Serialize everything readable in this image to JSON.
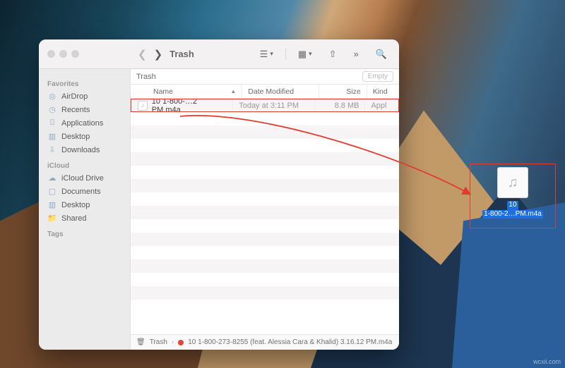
{
  "window": {
    "title": "Trash",
    "location_label": "Trash",
    "empty_button": "Empty"
  },
  "toolbar": {
    "view_mode": "list",
    "group_mode": "grid"
  },
  "sidebar": {
    "sections": [
      {
        "header": "Favorites",
        "items": [
          {
            "icon": "airdrop-icon",
            "label": "AirDrop"
          },
          {
            "icon": "clock-icon",
            "label": "Recents"
          },
          {
            "icon": "apps-icon",
            "label": "Applications"
          },
          {
            "icon": "desktop-icon",
            "label": "Desktop"
          },
          {
            "icon": "downloads-icon",
            "label": "Downloads"
          }
        ]
      },
      {
        "header": "iCloud",
        "items": [
          {
            "icon": "cloud-icon",
            "label": "iCloud Drive"
          },
          {
            "icon": "doc-icon",
            "label": "Documents"
          },
          {
            "icon": "desktop-icon",
            "label": "Desktop"
          },
          {
            "icon": "folder-icon",
            "label": "Shared"
          }
        ]
      },
      {
        "header": "Tags",
        "items": []
      }
    ]
  },
  "columns": {
    "name": "Name",
    "date": "Date Modified",
    "size": "Size",
    "kind": "Kind"
  },
  "file": {
    "name": "10 1-800-…2 PM.m4a",
    "date": "Today at 3:11 PM",
    "size": "8.8 MB",
    "kind": "Appl"
  },
  "pathbar": {
    "root": "Trash",
    "file": "10 1-800-273-8255 (feat. Alessia Cara & Khalid) 3.16.12 PM.m4a"
  },
  "desktop_target": {
    "line1": "10",
    "line2": "1-800-2…PM.m4a"
  },
  "watermark": "wcxii.com",
  "colors": {
    "annotation": "#e23b2e",
    "selection": "#1f6fe0"
  }
}
